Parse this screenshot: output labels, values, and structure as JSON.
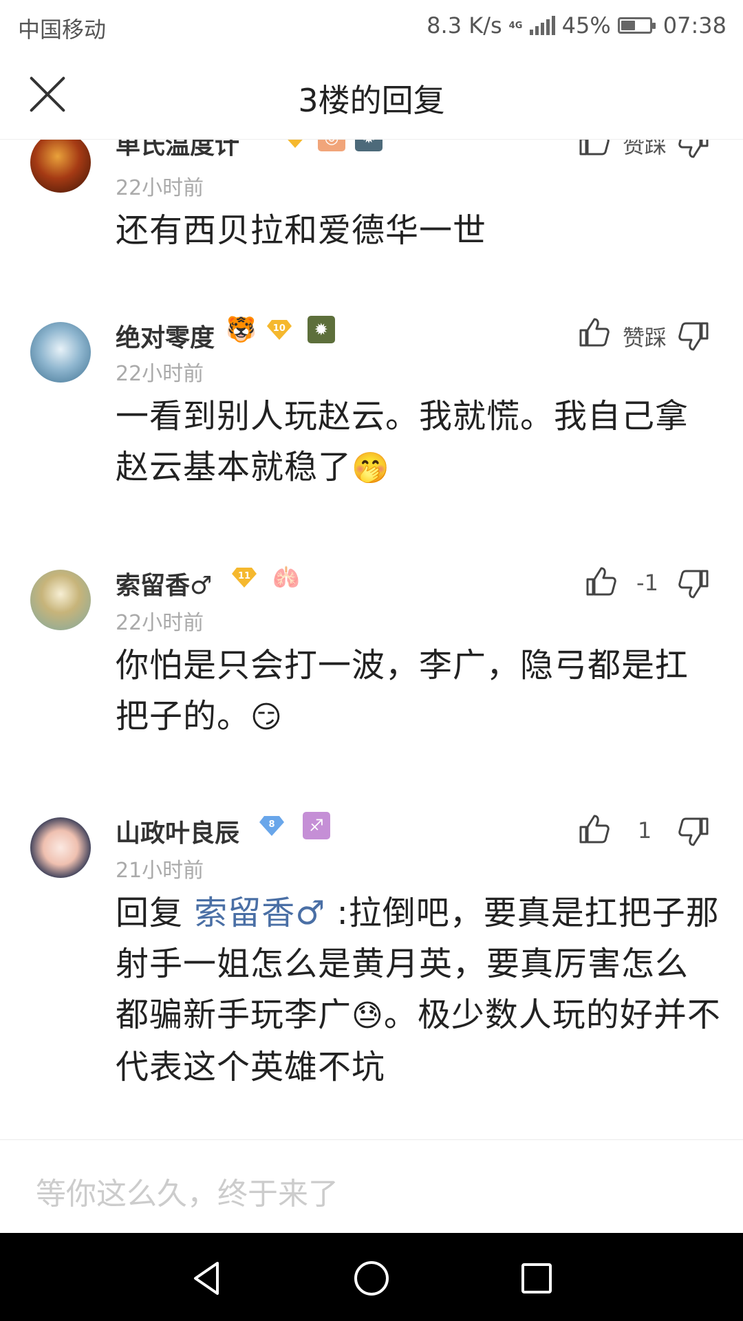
{
  "status_bar": {
    "carrier": "中国移动",
    "speed": "8.3 K/s",
    "network": "4G",
    "battery": "45%",
    "battery_level": 0.45,
    "time": "07:38"
  },
  "header": {
    "title": "3楼的回复"
  },
  "comments": [
    {
      "username": "单氏温度计",
      "time": "22小时前",
      "text": "还有西贝拉和爱德华一世",
      "vote_label": "赞踩"
    },
    {
      "username": "绝对零度",
      "badge_emoji": "🐯",
      "level": "10",
      "time": "22小时前",
      "text": "一看到别人玩赵云。我就慌。我自己拿赵云基本就稳了",
      "emoji": "🤭",
      "vote_label": "赞踩"
    },
    {
      "username": "索留香♂",
      "level": "11",
      "badge_emoji": "🫁",
      "time": "22小时前",
      "text": "你怕是只会打一波，李广，隐弓都是扛把子的。",
      "emoji": "😏",
      "vote_label": "-1"
    },
    {
      "username": "山政叶良辰",
      "level": "8",
      "badge_emoji": "♐",
      "time": "21小时前",
      "reply_prefix": "回复 ",
      "mention": "索留香♂",
      "text_part1": " :拉倒吧，要真是扛把子那射手一姐怎么是黄月英，要真厉害怎么都骗新手玩李广",
      "emoji": "😓",
      "text_part2": "。极少数人玩的好并不代表这个英雄不坑",
      "vote_label": "1"
    }
  ],
  "reply_bar": {
    "placeholder": "等你这么久，终于来了"
  },
  "nav_bar": {
    "back_icon": "triangle-back",
    "home_icon": "circle-home",
    "recents_icon": "square-recents"
  }
}
